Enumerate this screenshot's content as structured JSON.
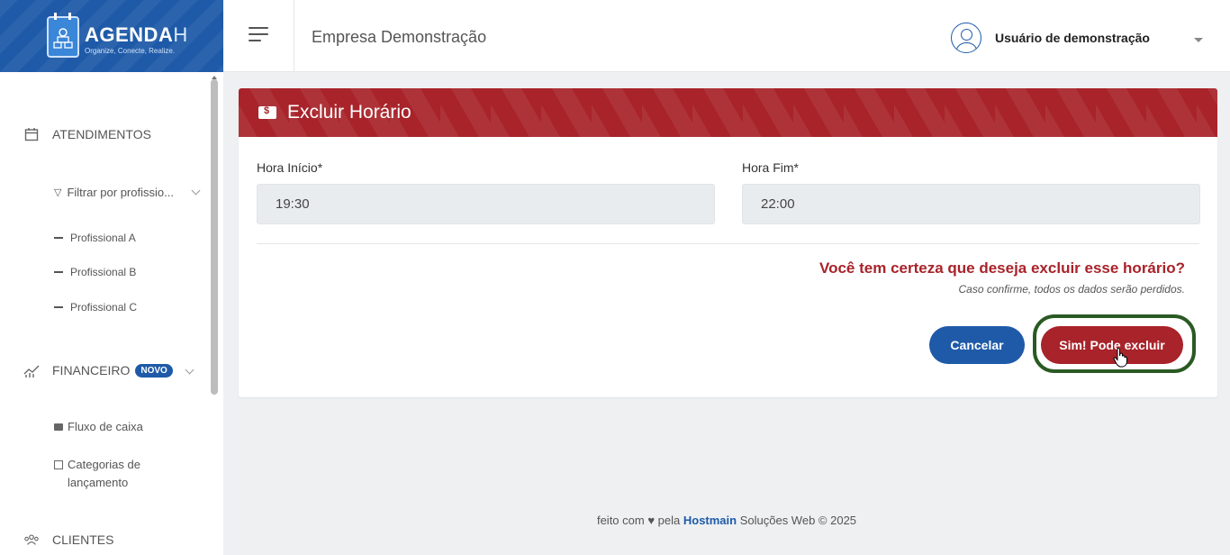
{
  "brand": {
    "name": "AGENDA",
    "name_suffix": "H",
    "tagline": "Organize, Conecte, Realize."
  },
  "topbar": {
    "company": "Empresa Demonstração",
    "user": "Usuário de demonstração"
  },
  "sidebar": {
    "atendimentos": "ATENDIMENTOS",
    "filter": "Filtrar por profissio...",
    "professionals": [
      "Profissional A",
      "Profissional B",
      "Profissional C"
    ],
    "financeiro": "FINANCEIRO",
    "novo_badge": "NOVO",
    "fluxo": "Fluxo de caixa",
    "categorias": "Categorias de lançamento",
    "clientes": "CLIENTES"
  },
  "card": {
    "title": "Excluir Horário",
    "start_label": "Hora Início*",
    "start_value": "19:30",
    "end_label": "Hora Fim*",
    "end_value": "22:00",
    "question": "Você tem certeza que deseja excluir esse horário?",
    "warning": "Caso confirme, todos os dados serão perdidos.",
    "cancel_label": "Cancelar",
    "confirm_label": "Sim! Pode excluir"
  },
  "footer": {
    "prefix": "feito com ♥ pela",
    "company": "Hostmain",
    "suffix": "Soluções Web © 2025"
  },
  "colors": {
    "primary": "#1e5aa8",
    "danger": "#a8232a",
    "highlight": "#2a5a23"
  }
}
